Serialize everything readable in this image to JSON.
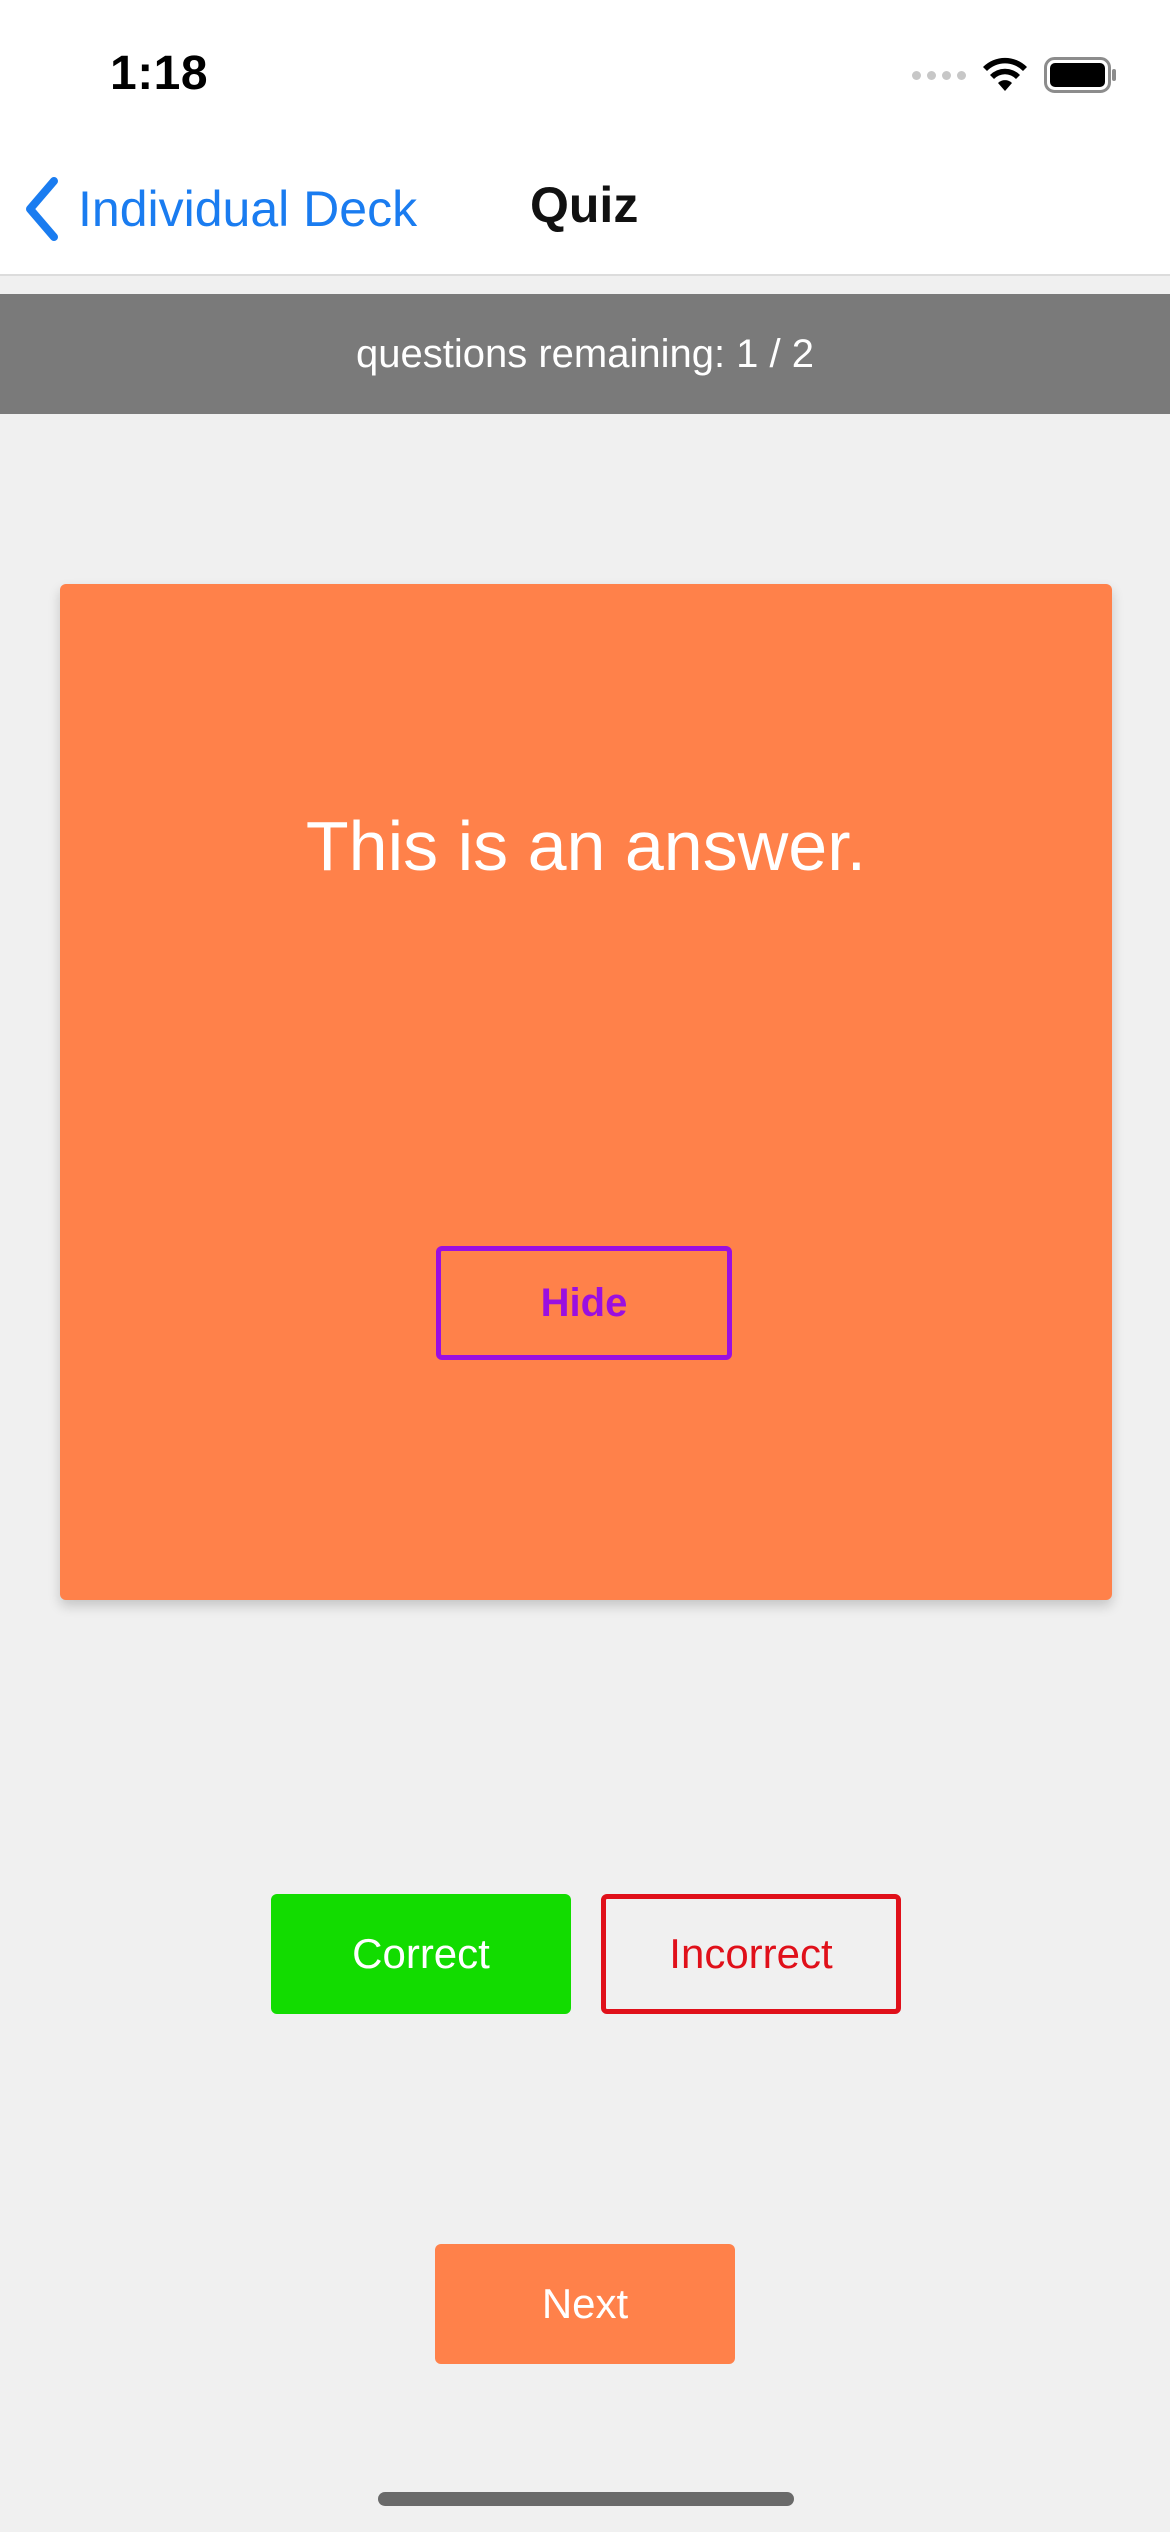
{
  "status_bar": {
    "time": "1:18",
    "icons": [
      "signal-icon",
      "wifi-icon",
      "battery-icon"
    ]
  },
  "nav": {
    "back_label": "Individual Deck",
    "title": "Quiz",
    "back_icon": "chevron-left-icon"
  },
  "progress": {
    "text": "questions remaining: 1 / 2"
  },
  "card": {
    "text": "This is an answer.",
    "hide_label": "Hide"
  },
  "actions": {
    "correct_label": "Correct",
    "incorrect_label": "Incorrect",
    "next_label": "Next"
  },
  "colors": {
    "accent_blue": "#1a7cf0",
    "card_orange": "#ff814a",
    "hide_purple": "#9b0fe0",
    "correct_green": "#12dc00",
    "incorrect_red": "#e0101a",
    "banner_gray": "#7a7a7a",
    "background": "#f0f0f0"
  }
}
